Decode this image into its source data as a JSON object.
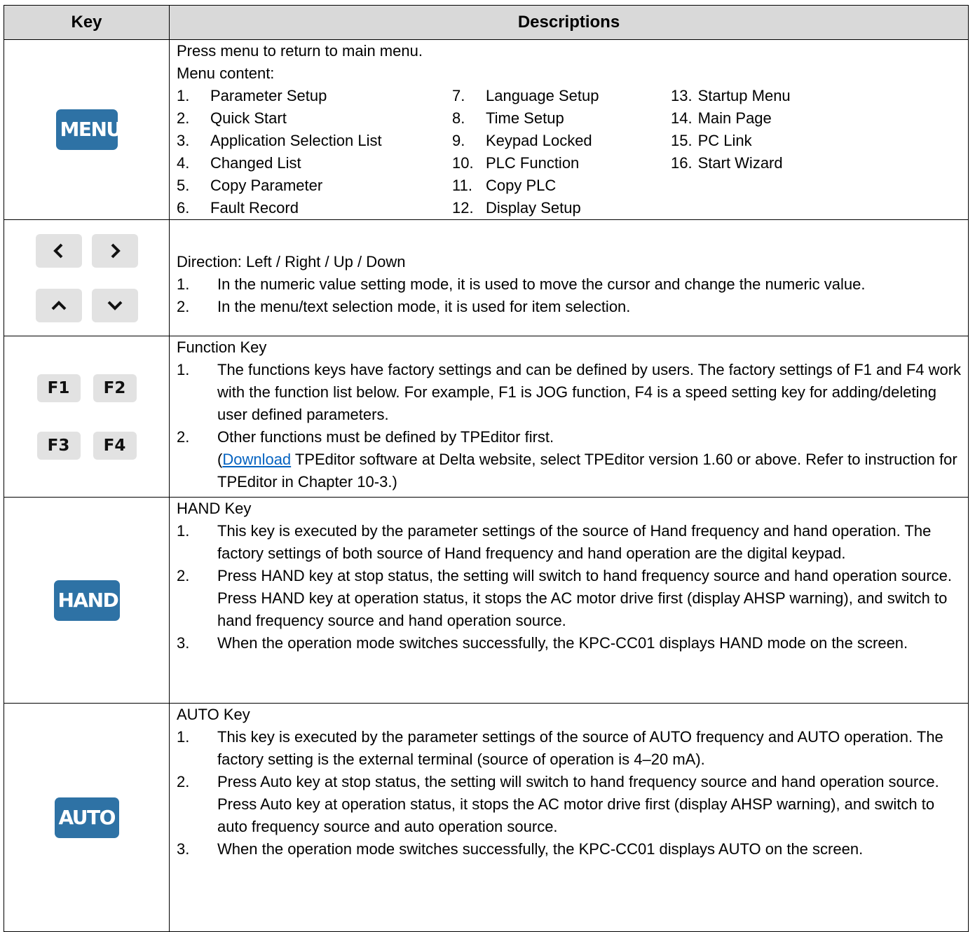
{
  "header": {
    "key": "Key",
    "descriptions": "Descriptions"
  },
  "rows": {
    "menu": {
      "key_label": "MENU",
      "intro": "Press menu to return to main menu.",
      "content_label": "Menu content:",
      "col1": [
        {
          "n": "1.",
          "t": "Parameter Setup"
        },
        {
          "n": "2.",
          "t": "Quick Start"
        },
        {
          "n": "3.",
          "t": "Application Selection List"
        },
        {
          "n": "4.",
          "t": "Changed List"
        },
        {
          "n": "5.",
          "t": "Copy Parameter"
        },
        {
          "n": "6.",
          "t": "Fault Record"
        }
      ],
      "col2": [
        {
          "n": "7.",
          "t": "Language Setup"
        },
        {
          "n": "8.",
          "t": "Time Setup"
        },
        {
          "n": "9.",
          "t": "Keypad Locked"
        },
        {
          "n": "10.",
          "t": "PLC Function"
        },
        {
          "n": "11.",
          "t": "Copy PLC"
        },
        {
          "n": "12.",
          "t": "Display Setup"
        }
      ],
      "col3": [
        {
          "n": "13.",
          "t": "Startup Menu"
        },
        {
          "n": "14.",
          "t": "Main Page"
        },
        {
          "n": "15.",
          "t": "PC Link"
        },
        {
          "n": "16.",
          "t": "Start Wizard"
        }
      ]
    },
    "direction": {
      "keys": {
        "left": "<",
        "right": ">",
        "up": "^",
        "down": "v"
      },
      "title": "Direction: Left / Right / Up / Down",
      "items": [
        {
          "n": "1.",
          "t": "In the numeric value setting mode, it is used to move the cursor and change the numeric value."
        },
        {
          "n": "2.",
          "t": "In the menu/text selection mode, it is used for item selection."
        }
      ]
    },
    "function": {
      "keys": [
        "F1",
        "F2",
        "F3",
        "F4"
      ],
      "title": "Function Key",
      "item1": {
        "n": "1.",
        "t": "The functions keys have factory settings and can be defined by users. The factory settings of F1 and F4 work with the function list below. For example, F1 is JOG function, F4 is a speed setting key for adding/deleting user defined parameters."
      },
      "item2": {
        "n": "2.",
        "t": "Other functions must be defined by TPEditor first."
      },
      "paren_open": "(",
      "link_text": "Download",
      "paren_rest": " TPEditor software at Delta website, select TPEditor version 1.60 or above. Refer to instruction for TPEditor in Chapter 10-3.)"
    },
    "hand": {
      "key_label": "HAND",
      "title": "HAND Key",
      "items": [
        {
          "n": "1.",
          "t": "This key is executed by the parameter settings of the source of Hand frequency and hand operation. The factory settings of both source of Hand frequency and hand operation are the digital keypad."
        },
        {
          "n": "2.",
          "t": "Press HAND key at stop status, the setting will switch to hand frequency source and hand operation source. Press HAND key at operation status, it stops the AC motor drive first (display AHSP warning), and switch to hand frequency source and hand operation source."
        },
        {
          "n": "3.",
          "t": "When the operation mode switches successfully, the KPC-CC01 displays HAND mode on the screen."
        }
      ]
    },
    "auto": {
      "key_label": "AUTO",
      "title": "AUTO Key",
      "items": [
        {
          "n": "1.",
          "t": "This key is executed by the parameter settings of the source of AUTO frequency and AUTO operation. The factory setting is the external terminal (source of operation is 4–20 mA)."
        },
        {
          "n": "2.",
          "t": "Press Auto key at stop status, the setting will switch to hand frequency source and hand operation source. Press Auto key at operation status, it stops the AC motor drive first (display AHSP warning), and switch to auto frequency source and auto operation source."
        },
        {
          "n": "3.",
          "t": "When the operation mode switches successfully, the KPC-CC01 displays AUTO on the screen."
        }
      ]
    }
  }
}
